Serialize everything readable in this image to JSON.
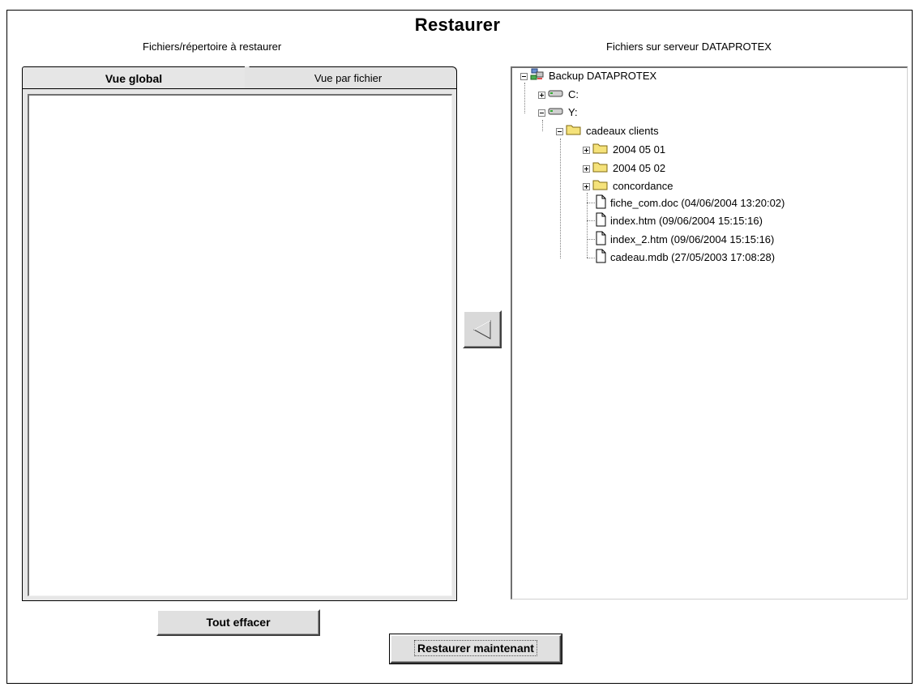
{
  "window": {
    "title": "Restaurer"
  },
  "left_panel": {
    "heading": "Fichiers/répertoire à restaurer",
    "tabs": [
      {
        "label": "Vue global",
        "active": true
      },
      {
        "label": "Vue par fichier",
        "active": false
      }
    ]
  },
  "right_panel": {
    "heading": "Fichiers sur serveur DATAPROTEX",
    "tree": {
      "root": "Backup DATAPROTEX",
      "drive_c": "C:",
      "drive_y": "Y:",
      "folder": "cadeaux clients",
      "subfolders": [
        "2004 05 01",
        "2004 05 02",
        "concordance"
      ],
      "files": [
        "fiche_com.doc (04/06/2004 13:20:02)",
        "index.htm (09/06/2004 15:15:16)",
        "index_2.htm (09/06/2004 15:15:16)",
        "cadeau.mdb (27/05/2003 17:08:28)"
      ]
    }
  },
  "buttons": {
    "clear": "Tout effacer",
    "restore": "Restaurer maintenant"
  },
  "icons": {
    "transfer": "left-arrow-icon",
    "server": "server-icon",
    "drive": "drive-icon",
    "folder": "folder-icon",
    "file": "file-icon"
  }
}
